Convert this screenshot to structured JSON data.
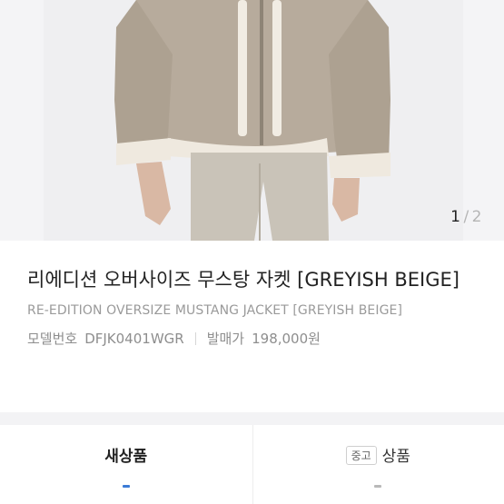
{
  "gallery": {
    "current": "1",
    "separator": "/",
    "total": "2"
  },
  "product": {
    "title_ko": "리에디션 오버사이즈 무스탕 자켓 [GREYISH BEIGE]",
    "title_en": "RE-EDITION OVERSIZE MUSTANG JACKET [GREYISH BEIGE]",
    "model_label": "모델번호",
    "model_value": "DFJK0401WGR",
    "price_label": "발매가",
    "price_value": "198,000원"
  },
  "tabs": {
    "new_label": "새상품",
    "used_badge": "중고",
    "used_label": "상품",
    "new_indicator_color": "#3b7bd6",
    "used_indicator_color": "#b9b9b9"
  }
}
